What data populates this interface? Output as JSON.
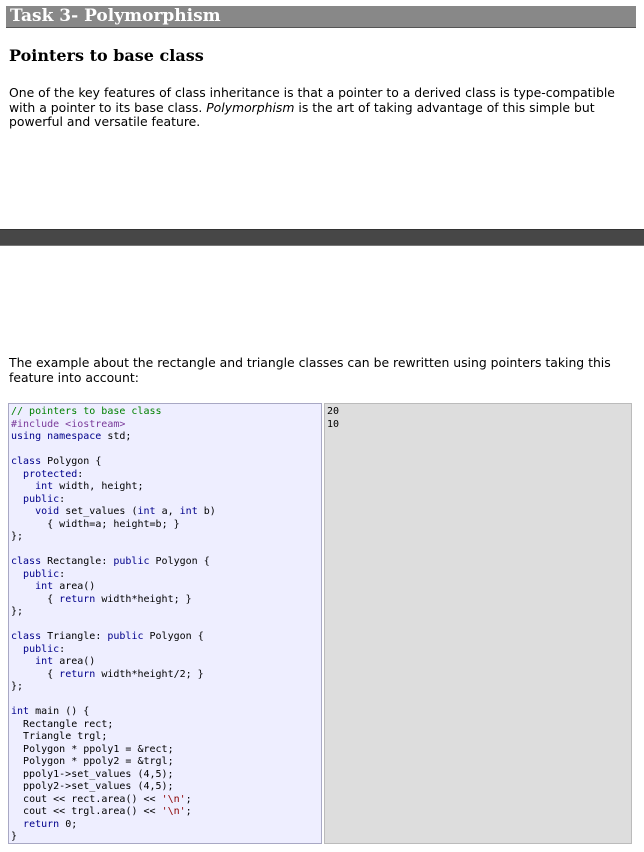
{
  "task_title": "Task 3- Polymorphism",
  "section_heading": "Pointers to base class",
  "intro_para": {
    "before": "One of the key features of class inheritance is that a pointer to a derived class is type-compatible with a pointer to its base class. ",
    "emphasis": "Polymorphism",
    "after": " is the art of taking advantage of this simple but powerful and versatile feature."
  },
  "example_para": "The example about the rectangle and triangle classes can be rewritten using pointers taking this feature into account:",
  "code_lines": [
    "// pointers to base class",
    "#include <iostream>",
    "using namespace std;",
    "",
    "class Polygon {",
    "  protected:",
    "    int width, height;",
    "  public:",
    "    void set_values (int a, int b)",
    "      { width=a; height=b; }",
    "};",
    "",
    "class Rectangle: public Polygon {",
    "  public:",
    "    int area()",
    "      { return width*height; }",
    "};",
    "",
    "class Triangle: public Polygon {",
    "  public:",
    "    int area()",
    "      { return width*height/2; }",
    "};",
    "",
    "int main () {",
    "  Rectangle rect;",
    "  Triangle trgl;",
    "  Polygon * ppoly1 = &rect;",
    "  Polygon * ppoly2 = &trgl;",
    "  ppoly1->set_values (4,5);",
    "  ppoly2->set_values (4,5);",
    "  cout << rect.area() << '\\n';",
    "  cout << trgl.area() << '\\n';",
    "  return 0;",
    "}"
  ],
  "output_lines": [
    "20",
    "10"
  ]
}
